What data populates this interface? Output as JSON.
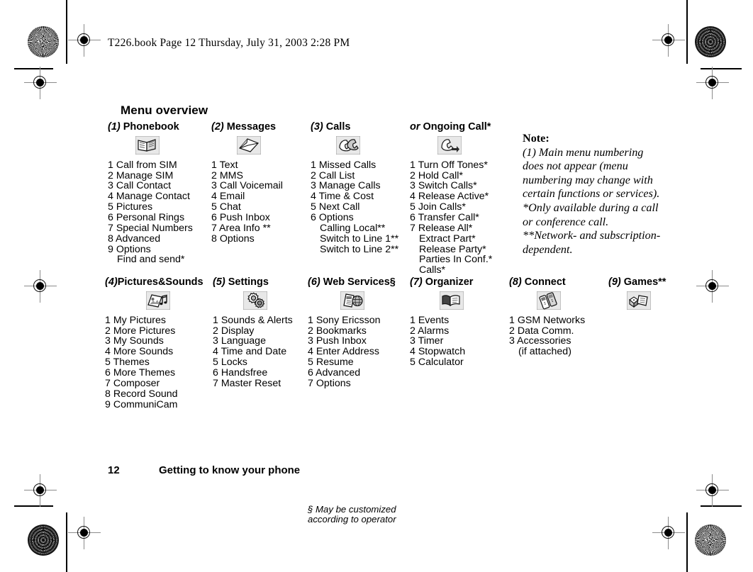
{
  "book_header": "T226.book  Page 12  Thursday, July 31, 2003  2:28 PM",
  "page_title": "Menu overview",
  "footer": {
    "page_number": "12",
    "section": "Getting to know your phone"
  },
  "note": {
    "label": "Note:",
    "lines": [
      "(1) Main menu numbering",
      "does not appear (menu",
      "numbering may change with",
      "certain functions or services).",
      "*Only available during a call",
      "or conference call.",
      "**Network- and subscription-",
      "dependent."
    ]
  },
  "footnotes": {
    "web_services": [
      "§ May be customized",
      "according to operator"
    ]
  },
  "columns": [
    {
      "number": "(1)",
      "title": "Phonebook",
      "icon": "phonebook-icon",
      "items": [
        {
          "text": "1 Call from SIM",
          "sub": false
        },
        {
          "text": "2 Manage SIM",
          "sub": false
        },
        {
          "text": "3 Call Contact",
          "sub": false
        },
        {
          "text": "4 Manage Contact",
          "sub": false
        },
        {
          "text": "5 Pictures",
          "sub": false
        },
        {
          "text": "6 Personal Rings",
          "sub": false
        },
        {
          "text": "7 Special Numbers",
          "sub": false
        },
        {
          "text": "8 Advanced",
          "sub": false
        },
        {
          "text": "9 Options",
          "sub": false
        },
        {
          "text": "Find and send*",
          "sub": true
        }
      ]
    },
    {
      "number": "(2)",
      "title": "Messages",
      "icon": "envelope-icon",
      "items": [
        {
          "text": "1 Text",
          "sub": false
        },
        {
          "text": "2 MMS",
          "sub": false
        },
        {
          "text": "3 Call Voicemail",
          "sub": false
        },
        {
          "text": "4 Email",
          "sub": false
        },
        {
          "text": "5 Chat",
          "sub": false
        },
        {
          "text": "6 Push Inbox",
          "sub": false
        },
        {
          "text": "7 Area Info **",
          "sub": false
        },
        {
          "text": "8 Options",
          "sub": false
        }
      ]
    },
    {
      "number": "(3)",
      "title": "Calls",
      "icon": "handsets-icon",
      "items": [
        {
          "text": "1 Missed Calls",
          "sub": false
        },
        {
          "text": "2 Call List",
          "sub": false
        },
        {
          "text": "3 Manage Calls",
          "sub": false
        },
        {
          "text": "4 Time & Cost",
          "sub": false
        },
        {
          "text": "5 Next Call",
          "sub": false
        },
        {
          "text": "6 Options",
          "sub": false
        },
        {
          "text": "Calling Local**",
          "sub": true
        },
        {
          "text": "Switch to Line 1**",
          "sub": true
        },
        {
          "text": "Switch to Line 2**",
          "sub": true
        }
      ]
    },
    {
      "number": "or",
      "title": "Ongoing Call*",
      "icon": "ongoing-call-icon",
      "items": [
        {
          "text": "1 Turn Off Tones*",
          "sub": false
        },
        {
          "text": "2 Hold Call*",
          "sub": false
        },
        {
          "text": "3 Switch Calls*",
          "sub": false
        },
        {
          "text": "4 Release Active*",
          "sub": false
        },
        {
          "text": "5 Join Calls*",
          "sub": false
        },
        {
          "text": "6 Transfer Call*",
          "sub": false
        },
        {
          "text": "7 Release All*",
          "sub": false
        },
        {
          "text": "Extract Part*",
          "sub": true
        },
        {
          "text": "Release Party*",
          "sub": true
        },
        {
          "text": "Parties In Conf.*",
          "sub": true
        },
        {
          "text": "Calls*",
          "sub": true
        }
      ]
    },
    {
      "number": "(4)",
      "title": "Pictures&Sounds",
      "icon": "pictures-sounds-icon",
      "items": [
        {
          "text": "1 My Pictures",
          "sub": false
        },
        {
          "text": "2 More Pictures",
          "sub": false
        },
        {
          "text": "3 My Sounds",
          "sub": false
        },
        {
          "text": "4 More Sounds",
          "sub": false
        },
        {
          "text": "5 Themes",
          "sub": false
        },
        {
          "text": "6 More Themes",
          "sub": false
        },
        {
          "text": "7 Composer",
          "sub": false
        },
        {
          "text": "8 Record Sound",
          "sub": false
        },
        {
          "text": "9 CommuniCam",
          "sub": false
        }
      ]
    },
    {
      "number": "(5)",
      "title": "Settings",
      "icon": "gears-icon",
      "items": [
        {
          "text": "1 Sounds & Alerts",
          "sub": false
        },
        {
          "text": "2 Display",
          "sub": false
        },
        {
          "text": "3 Language",
          "sub": false
        },
        {
          "text": "4 Time and Date",
          "sub": false
        },
        {
          "text": "5 Locks",
          "sub": false
        },
        {
          "text": "6 Handsfree",
          "sub": false
        },
        {
          "text": "7 Master Reset",
          "sub": false
        }
      ]
    },
    {
      "number": "(6)",
      "title": "Web Services§",
      "icon": "web-services-icon",
      "items": [
        {
          "text": "1 Sony Ericsson",
          "sub": false
        },
        {
          "text": "2 Bookmarks",
          "sub": false
        },
        {
          "text": "3 Push Inbox",
          "sub": false
        },
        {
          "text": "4 Enter Address",
          "sub": false
        },
        {
          "text": "5 Resume",
          "sub": false
        },
        {
          "text": "6 Advanced",
          "sub": false
        },
        {
          "text": "7 Options",
          "sub": false
        }
      ]
    },
    {
      "number": "(7)",
      "title": "Organizer",
      "icon": "organizer-icon",
      "items": [
        {
          "text": "1 Events",
          "sub": false
        },
        {
          "text": "2 Alarms",
          "sub": false
        },
        {
          "text": "3 Timer",
          "sub": false
        },
        {
          "text": "4 Stopwatch",
          "sub": false
        },
        {
          "text": "5 Calculator",
          "sub": false
        }
      ]
    },
    {
      "number": "(8)",
      "title": "Connect",
      "icon": "connect-icon",
      "items": [
        {
          "text": "1 GSM Networks",
          "sub": false
        },
        {
          "text": "2 Data Comm.",
          "sub": false
        },
        {
          "text": "3 Accessories",
          "sub": false
        },
        {
          "text": "(if attached)",
          "sub": true
        }
      ]
    },
    {
      "number": "(9)",
      "title": "Games**",
      "icon": "games-icon",
      "items": []
    }
  ]
}
